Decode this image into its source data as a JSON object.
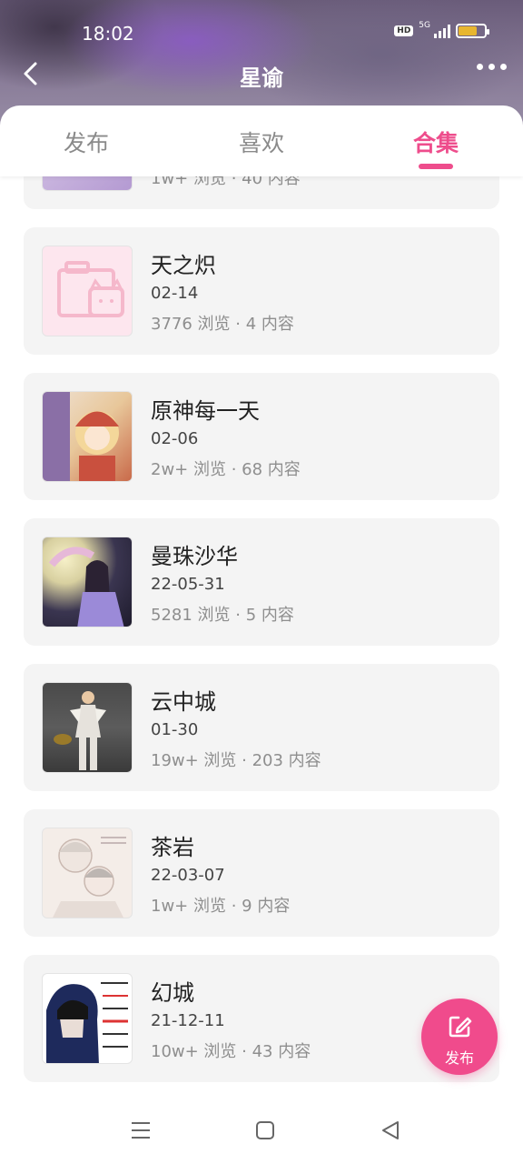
{
  "status_bar": {
    "time": "18:02",
    "hd": "HD",
    "network": "5G"
  },
  "nav": {
    "title": "星谕",
    "back_icon": "chevron-left-icon",
    "more_icon": "more-horizontal-icon"
  },
  "tabs": [
    {
      "label": "发布",
      "active": false
    },
    {
      "label": "喜欢",
      "active": false
    },
    {
      "label": "合集",
      "active": true
    }
  ],
  "accent_color": "#ee4d8c",
  "partial_card": {
    "stats": "1w+ 浏览 · 40 内容"
  },
  "collections": [
    {
      "title": "天之炽",
      "date": "02-14",
      "stats": "3776 浏览 · 4 内容"
    },
    {
      "title": "原神每一天",
      "date": "02-06",
      "stats": "2w+ 浏览 · 68 内容"
    },
    {
      "title": "曼珠沙华",
      "date": "22-05-31",
      "stats": "5281 浏览 · 5 内容"
    },
    {
      "title": "云中城",
      "date": "01-30",
      "stats": "19w+ 浏览 · 203 内容"
    },
    {
      "title": "茶岩",
      "date": "22-03-07",
      "stats": "1w+ 浏览 · 9 内容"
    },
    {
      "title": "幻城",
      "date": "21-12-11",
      "stats": "10w+ 浏览 · 43 内容"
    }
  ],
  "fab": {
    "label": "发布",
    "icon": "edit-icon"
  },
  "system_nav": [
    "menu-icon",
    "home-square-icon",
    "back-triangle-icon"
  ]
}
